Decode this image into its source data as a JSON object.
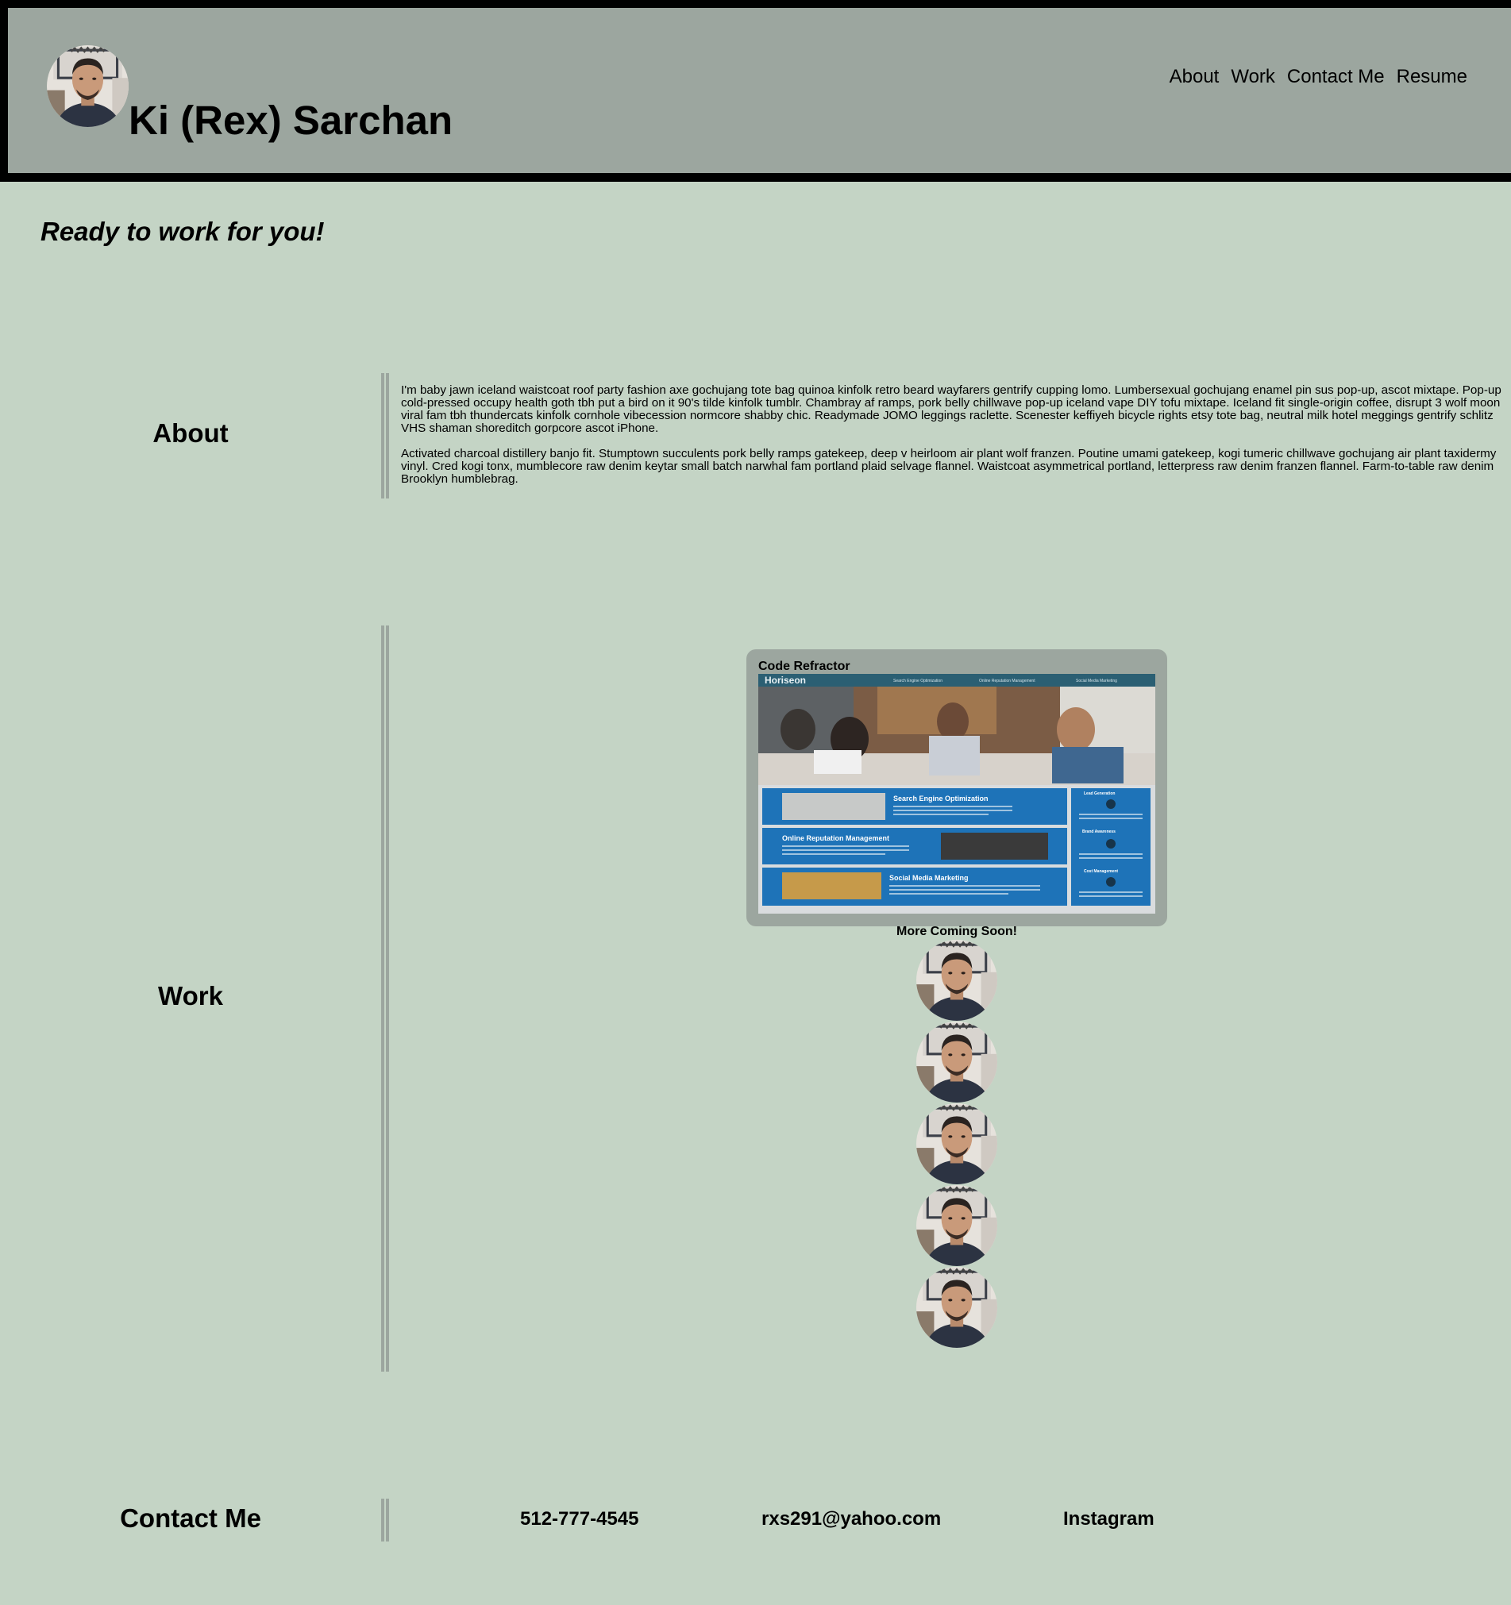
{
  "header": {
    "title": "Ki (Rex) Sarchan",
    "avatar_icon": "profile-photo-icon",
    "nav": [
      {
        "label": "About"
      },
      {
        "label": "Work"
      },
      {
        "label": "Contact Me"
      },
      {
        "label": "Resume"
      }
    ]
  },
  "tagline": "Ready to work for you!",
  "about": {
    "heading": "About",
    "paragraphs": [
      "I'm baby jawn iceland waistcoat roof party fashion axe gochujang tote bag quinoa kinfolk retro beard wayfarers gentrify cupping lomo. Lumbersexual gochujang enamel pin sus pop-up, ascot mixtape. Pop-up cold-pressed occupy health goth tbh put a bird on it 90's tilde kinfolk tumblr. Chambray af ramps, pork belly chillwave pop-up iceland vape DIY tofu mixtape. Iceland fit single-origin coffee, disrupt 3 wolf moon viral fam tbh thundercats kinfolk cornhole vibecession normcore shabby chic. Readymade JOMO leggings raclette. Scenester keffiyeh bicycle rights etsy tote bag, neutral milk hotel meggings gentrify schlitz VHS shaman shoreditch gorpcore ascot iPhone.",
      "Activated charcoal distillery banjo fit. Stumptown succulents pork belly ramps gatekeep, deep v heirloom air plant wolf franzen. Poutine umami gatekeep, kogi tumeric chillwave gochujang air plant taxidermy vinyl. Cred kogi tonx, mumblecore raw denim keytar small batch narwhal fam portland plaid selvage flannel. Waistcoat asymmetrical portland, letterpress raw denim franzen flannel. Farm-to-table raw denim Brooklyn humblebrag."
    ]
  },
  "work": {
    "heading": "Work",
    "project": {
      "title": "Code Refractor",
      "screenshot": {
        "brand": "Horiseon",
        "nav": [
          "Search Engine Optimization",
          "Online Reputation Management",
          "Social Media Marketing"
        ],
        "sections": [
          "Search Engine Optimization",
          "Online Reputation Management",
          "Social Media Marketing"
        ],
        "sidebar": [
          "Lead Generation",
          "Brand Awareness",
          "Cost Management"
        ]
      }
    },
    "coming_soon": "More Coming Soon!",
    "placeholders": 5
  },
  "contact": {
    "heading": "Contact Me",
    "phone": "512-777-4545",
    "email": "rxs291@yahoo.com",
    "social": "Instagram"
  },
  "colors": {
    "page_background": "#c4d4c5",
    "header_background": "#9ca69f",
    "header_border": "#000000",
    "divider": "#9ca69f",
    "card_background": "#9ca69f",
    "screenshot_blue": "#1e73b8"
  }
}
